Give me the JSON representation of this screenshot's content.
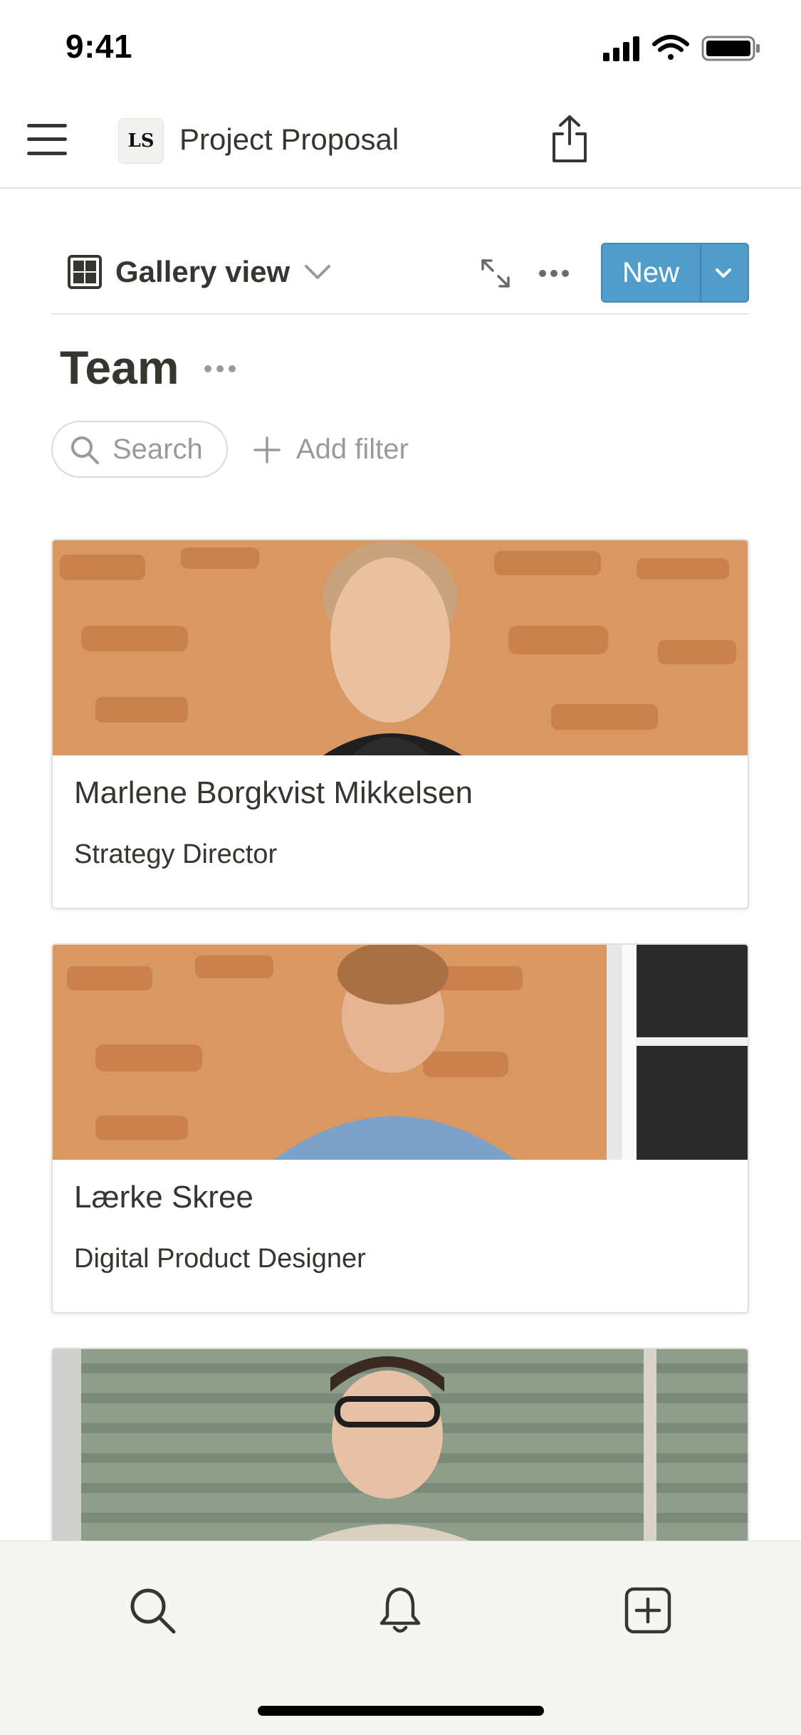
{
  "status_bar": {
    "time": "9:41"
  },
  "header": {
    "page_title": "Project Proposal",
    "logo_text": "LS"
  },
  "toolbar": {
    "view_label": "Gallery view",
    "new_label": "New"
  },
  "section": {
    "title": "Team"
  },
  "filters": {
    "search_label": "Search",
    "add_filter_label": "Add filter"
  },
  "cards": [
    {
      "name": "Marlene Borgkvist Mikkelsen",
      "role": "Strategy Director"
    },
    {
      "name": "Lærke Skree",
      "role": "Digital Product Designer"
    },
    {
      "name": "",
      "role": ""
    }
  ],
  "bottom_nav": {
    "items": [
      "search-icon",
      "bell-icon",
      "add-page-icon"
    ]
  },
  "colors": {
    "accent": "#529cca",
    "text": "#37352f",
    "muted": "#9b9a97",
    "bottom_bar": "#f5f5f3"
  }
}
